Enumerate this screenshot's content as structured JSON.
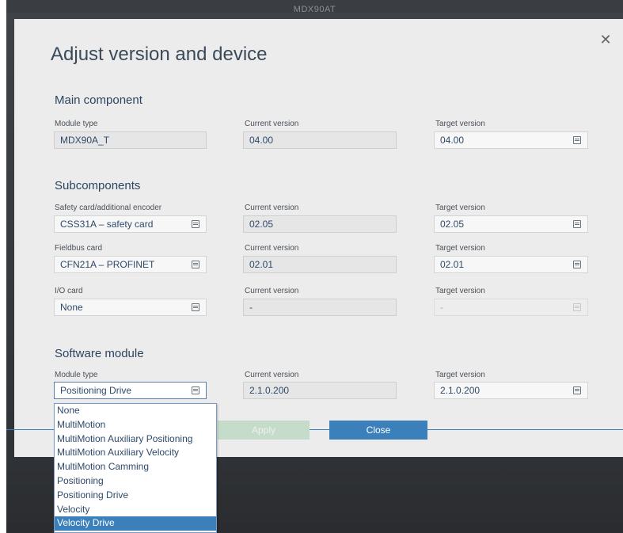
{
  "window": {
    "title": "MDX90AT"
  },
  "dialog": {
    "title": "Adjust version and device",
    "close_icon": "close-icon"
  },
  "main_component": {
    "heading": "Main component",
    "module_type": {
      "label": "Module type",
      "value": "MDX90A_T"
    },
    "current_version": {
      "label": "Current version",
      "value": "04.00"
    },
    "target_version": {
      "label": "Target version",
      "value": "04.00"
    }
  },
  "subcomponents": {
    "heading": "Subcomponents",
    "safety_card": {
      "label": "Safety card/additional encoder",
      "value": "CSS31A – safety card",
      "current_label": "Current version",
      "current": "02.05",
      "target_label": "Target version",
      "target": "02.05"
    },
    "fieldbus_card": {
      "label": "Fieldbus card",
      "value": "CFN21A – PROFINET",
      "current_label": "Current version",
      "current": "02.01",
      "target_label": "Target version",
      "target": "02.01"
    },
    "io_card": {
      "label": "I/O card",
      "value": "None",
      "current_label": "Current version",
      "current": "-",
      "target_label": "Target version",
      "target": "-"
    }
  },
  "software_module": {
    "heading": "Software module",
    "module_type": {
      "label": "Module type",
      "value": "Positioning Drive"
    },
    "current_version": {
      "label": "Current version",
      "value": "2.1.0.200"
    },
    "target_version": {
      "label": "Target version",
      "value": "2.1.0.200"
    },
    "dropdown_options": [
      "None",
      "MultiMotion",
      "MultiMotion Auxiliary Positioning",
      "MultiMotion Auxiliary Velocity",
      "MultiMotion Camming",
      "Positioning",
      "Positioning Drive",
      "Velocity",
      "Velocity Drive"
    ],
    "highlighted_option": "Velocity Drive"
  },
  "buttons": {
    "apply": "Apply",
    "close": "Close"
  },
  "colors": {
    "accent": "#3b7fbb",
    "apply_disabled": "#c6dccb",
    "heading": "#2b4460"
  }
}
